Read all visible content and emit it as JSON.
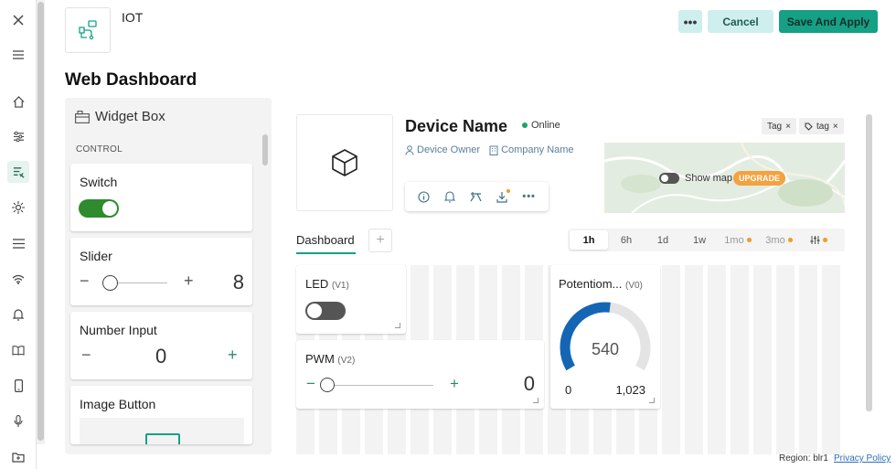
{
  "nav": {
    "items": [
      "close-icon",
      "menu-icon",
      "home-icon",
      "tuning-icon",
      "devices-icon",
      "automation-icon",
      "list-icon",
      "wifi-icon",
      "bell-icon",
      "book-icon",
      "phone-icon",
      "mic-icon",
      "folder-icon"
    ]
  },
  "header": {
    "template_name": "IOT",
    "more_label": "•••",
    "cancel_label": "Cancel",
    "save_label": "Save And Apply",
    "page_title": "Web Dashboard"
  },
  "widget_box": {
    "title": "Widget Box",
    "section": "CONTROL",
    "switch": {
      "label": "Switch",
      "on": true
    },
    "slider": {
      "label": "Slider",
      "minus": "−",
      "plus": "+",
      "value": "8",
      "level": 0.1
    },
    "number_input": {
      "label": "Number Input",
      "minus": "−",
      "plus": "+",
      "value": "0"
    },
    "image_button": {
      "label": "Image Button"
    }
  },
  "device": {
    "name": "Device Name",
    "status": "Online",
    "owner": "Device Owner",
    "company": "Company Name",
    "tags": [
      "Tag",
      "tag"
    ],
    "show_map": "Show map",
    "upgrade": "UPGRADE",
    "colors": {
      "online": "#1aa36b",
      "accent": "#16a086",
      "upgrade": "#f3a23f"
    }
  },
  "tabs": {
    "dashboard": "Dashboard",
    "add": "+"
  },
  "ranges": [
    "1h",
    "6h",
    "1d",
    "1w",
    "1mo",
    "3mo"
  ],
  "widgets": {
    "led": {
      "title": "LED",
      "pin": "(V1)",
      "on": false
    },
    "pwm": {
      "title": "PWM",
      "pin": "(V2)",
      "minus": "−",
      "plus": "+",
      "value": "0",
      "level": 0.0
    },
    "gauge": {
      "title": "Potentiom...",
      "pin": "(V0)",
      "value": "540",
      "min": "0",
      "max": "1,023",
      "fraction": 0.528
    }
  },
  "footer": {
    "region": "Region: blr1",
    "privacy": "Privacy Policy"
  }
}
